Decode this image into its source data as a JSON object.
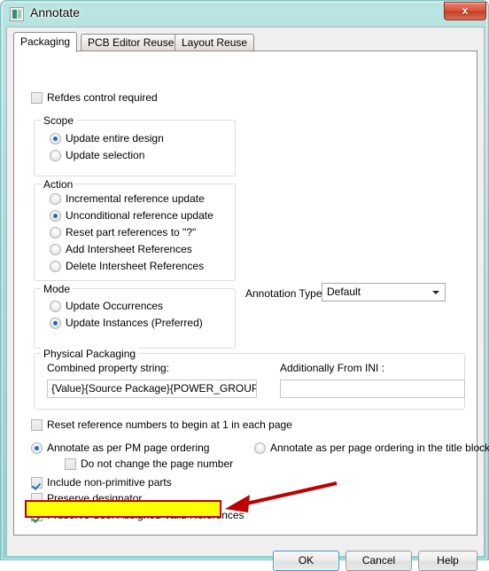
{
  "window": {
    "title": "Annotate",
    "icon": "app-window-icon",
    "close_label": "x",
    "frame_color": "#8fd3d1"
  },
  "tabs": [
    {
      "label": "Packaging",
      "active": true
    },
    {
      "label": "PCB Editor Reuse",
      "active": false
    },
    {
      "label": "Layout Reuse",
      "active": false
    }
  ],
  "packaging": {
    "refdes_control": {
      "label": "Refdes control required",
      "checked": false
    },
    "scope": {
      "title": "Scope",
      "options": [
        {
          "label": "Update entire design",
          "selected": true
        },
        {
          "label": "Update selection",
          "selected": false
        }
      ]
    },
    "action": {
      "title": "Action",
      "options": [
        {
          "label": "Incremental reference update",
          "selected": false
        },
        {
          "label": "Unconditional reference update",
          "selected": true
        },
        {
          "label": "Reset part references to \"?\"",
          "selected": false
        },
        {
          "label": "Add Intersheet References",
          "selected": false
        },
        {
          "label": "Delete Intersheet References",
          "selected": false
        }
      ]
    },
    "mode": {
      "title": "Mode",
      "options": [
        {
          "label": "Update Occurrences",
          "selected": false
        },
        {
          "label": "Update Instances (Preferred)",
          "selected": true
        }
      ]
    },
    "annotation_type": {
      "label": "Annotation Type",
      "value": "Default"
    },
    "physical_packaging": {
      "title": "Physical Packaging",
      "combined_label": "Combined property string:",
      "combined_value": "{Value}{Source Package}{POWER_GROUP}",
      "ini_label": "Additionally From INI :",
      "ini_value": ""
    },
    "reset_numbers": {
      "label": "Reset reference numbers to begin at 1 in each page",
      "checked": false
    },
    "ordering": [
      {
        "label": "Annotate as per PM page ordering",
        "selected": true
      },
      {
        "label": "Annotate as per page ordering in the title blocks",
        "selected": false
      }
    ],
    "do_not_change_page": {
      "label": "Do not change the page number",
      "checked": false
    },
    "include_non_primitive": {
      "label": "Include non-primitive parts",
      "checked": true
    },
    "preserve_designator": {
      "label": "Preserve designator",
      "checked": false
    },
    "preserve_user_refs": {
      "label": "Preserve User Assigned Valid References",
      "checked": true,
      "highlight_fill": "#ffff00",
      "highlight_border": "#c00000"
    }
  },
  "annotation_arrow": {
    "color": "#c00000",
    "points": "from upper-right to highlighted checkbox"
  },
  "buttons": {
    "ok": "OK",
    "cancel": "Cancel",
    "help": "Help"
  }
}
